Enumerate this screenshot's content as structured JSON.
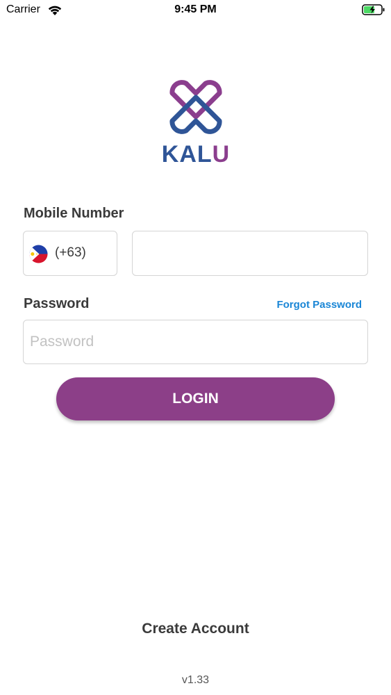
{
  "status_bar": {
    "carrier": "Carrier",
    "time": "9:45 PM",
    "wifi_icon": "wifi-icon",
    "battery_icon": "battery-charging-icon"
  },
  "logo": {
    "text_part1": "KAL",
    "text_part2": "U",
    "colors": {
      "blue": "#2f5597",
      "purple": "#8b3e8e"
    }
  },
  "form": {
    "mobile_label": "Mobile Number",
    "country_flag_icon": "philippines-flag-icon",
    "dial_code": "(+63)",
    "phone_value": "",
    "phone_placeholder": "",
    "password_label": "Password",
    "forgot_password": "Forgot Password",
    "password_value": "",
    "password_placeholder": "Password",
    "login_label": "LOGIN"
  },
  "footer": {
    "create_account": "Create Account",
    "version": "v1.33"
  },
  "colors": {
    "accent": "#8c3f88",
    "link": "#1a86d6",
    "text": "#3a3a3a"
  }
}
